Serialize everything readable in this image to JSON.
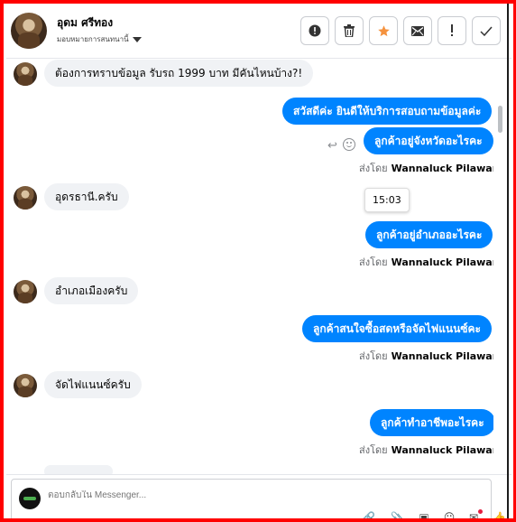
{
  "header": {
    "name": "อุดม ศรีทอง",
    "assign_label": "มอบหมายการสนทนานี้"
  },
  "toolbar": {
    "buttons": [
      {
        "name": "report-spam-button",
        "icon": "alert-circle-icon"
      },
      {
        "name": "delete-button",
        "icon": "trash-icon"
      },
      {
        "name": "star-button",
        "icon": "star-icon"
      },
      {
        "name": "mark-unread-button",
        "icon": "envelope-icon"
      },
      {
        "name": "follow-up-button",
        "icon": "exclamation-icon"
      },
      {
        "name": "mark-done-button",
        "icon": "check-icon"
      }
    ],
    "star_color": "#f5923e"
  },
  "messages": {
    "m1": "ต้องการทราบข้อมูล รับรถ 1999 บาท มีคันไหนบ้าง?!",
    "m2": "สวัสดีค่ะ  ยินดีให้บริการสอบถามข้อมูลค่ะ",
    "m3": "ลูกค้าอยู่จังหวัดอะไรคะ",
    "m4": "อุดรธานี.ครับ",
    "m5": "ลูกค้าอยู่อำเภออะไรคะ",
    "m6": "อำเภอเมืองครับ",
    "m7": "ลูกค้าสนใจซื้อสดหรือจัดไฟแนนซ์คะ",
    "m8": "จัดไฟแนนซ์ครับ",
    "m9": "ลูกค้าทำอาชีพอะไรคะ"
  },
  "sent_by": {
    "prefix": "ส่งโดย",
    "agent": "Wannaluck Pilawan"
  },
  "tooltip_time": "15:03",
  "composer": {
    "placeholder": "ตอบกลับใน Messenger..."
  },
  "colors": {
    "outgoing_bubble": "#0084ff",
    "incoming_bubble": "#f0f2f5",
    "frame": "#ff0000"
  }
}
